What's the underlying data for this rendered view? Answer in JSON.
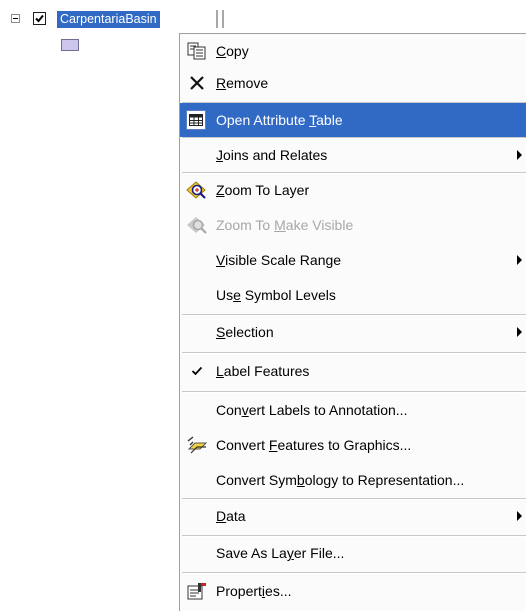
{
  "toc": {
    "layer_name": "CarpentariaBasin",
    "layer_checked": true,
    "expand_glyph": "minus-box",
    "swatch_color": "#cdc6ea",
    "highlight_color": "#316ac5"
  },
  "menu": {
    "items": [
      {
        "pre": "",
        "key": "",
        "post": "",
        "text": "Copy",
        "u": "C",
        "rest": "opy",
        "icon": "copy-icon"
      },
      {
        "text": "Remove",
        "u": "R",
        "rest": "emove",
        "icon": "remove-icon"
      },
      {
        "text": "Open Attribute Table",
        "pre": "Open Attribute ",
        "u": "T",
        "rest": "able",
        "icon": "table-icon",
        "highlighted": true
      },
      {
        "text": "Joins and Relates",
        "pre": "",
        "u": "J",
        "rest": "oins and Relates",
        "submenu": true
      },
      {
        "text": "Zoom To Layer",
        "pre": "",
        "u": "Z",
        "rest": "oom To Layer",
        "icon": "zoom-to-layer-icon"
      },
      {
        "text": "Zoom To Make Visible",
        "pre": "Zoom To ",
        "u": "M",
        "rest": "ake Visible",
        "icon": "zoom-visible-icon",
        "disabled": true
      },
      {
        "text": "Visible Scale Range",
        "pre": "",
        "u": "V",
        "rest": "isible Scale Range",
        "submenu": true
      },
      {
        "text": "Use Symbol Levels",
        "pre": "Us",
        "u": "e",
        "rest": " Symbol Levels"
      },
      {
        "text": "Selection",
        "pre": "",
        "u": "S",
        "rest": "election",
        "submenu": true
      },
      {
        "text": "Label Features",
        "pre": "",
        "u": "L",
        "rest": "abel Features",
        "checked": true
      },
      {
        "text": "Convert Labels to Annotation...",
        "pre": "Con",
        "u": "v",
        "rest": "ert Labels to Annotation..."
      },
      {
        "text": "Convert Features to Graphics...",
        "pre": "Convert ",
        "u": "F",
        "rest": "eatures to Graphics...",
        "icon": "convert-graphics-icon"
      },
      {
        "text": "Convert Symbology to Representation...",
        "pre": "Convert Sym",
        "u": "b",
        "rest": "ology to Representation..."
      },
      {
        "text": "Data",
        "pre": "",
        "u": "D",
        "rest": "ata",
        "submenu": true
      },
      {
        "text": "Save As Layer File...",
        "pre": "Save As La",
        "u": "y",
        "rest": "er File..."
      },
      {
        "text": "Properties...",
        "pre": "Propert",
        "u": "i",
        "rest": "es...",
        "icon": "properties-icon"
      }
    ]
  }
}
